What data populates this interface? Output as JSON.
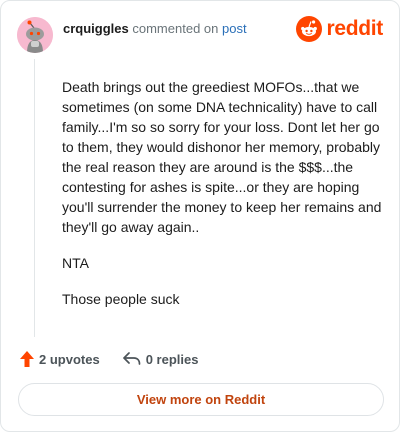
{
  "header": {
    "username": "crquiggles",
    "action_text": "commented on",
    "post_link": "post",
    "brand_name": "reddit",
    "brand_color": "#ff4500",
    "avatar_icon": "snoo-avatar-icon",
    "avatar_color": "#f7b9cf"
  },
  "comment": {
    "paragraphs": [
      "Death brings out the greediest MOFOs...that we sometimes (on some DNA technicality) have to call family...I'm so so sorry for your loss. Dont let her go to them, they would dishonor her memory, probably the real reason they are around is the $$$...the contesting for ashes is spite...or they are hoping you'll surrender the money to keep her remains and they'll go away again..",
      "NTA",
      "Those people suck"
    ]
  },
  "actions": {
    "upvotes_label": "2 upvotes",
    "replies_label": "0 replies",
    "upvote_icon": "upvote-arrow-icon",
    "reply_icon": "reply-arrow-icon"
  },
  "footer": {
    "view_more_label": "View more on Reddit",
    "view_more_color": "#c1440e"
  }
}
